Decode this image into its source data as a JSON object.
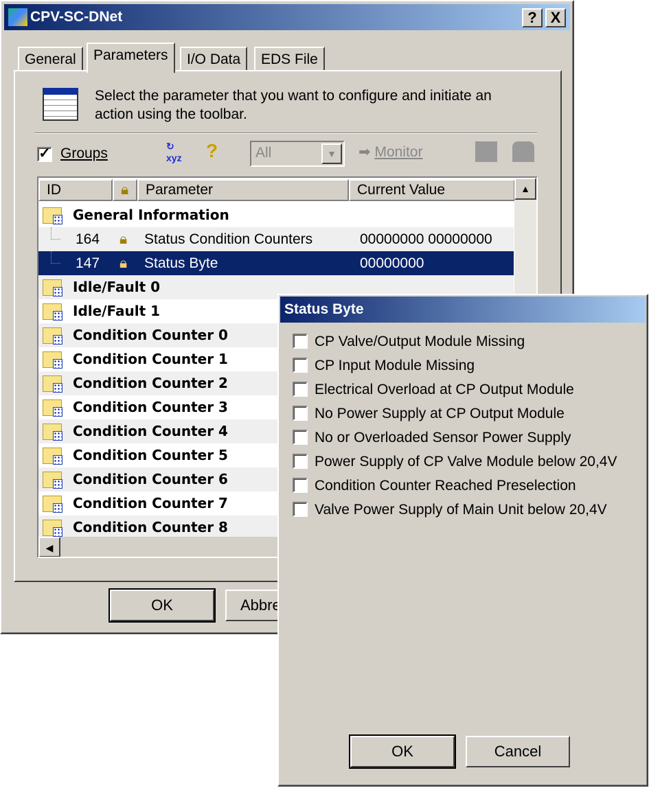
{
  "window": {
    "title": "CPV-SC-DNet",
    "help": "?",
    "close": "X"
  },
  "tabs": [
    {
      "label": "General"
    },
    {
      "label": "Parameters",
      "active": true
    },
    {
      "label": "I/O Data"
    },
    {
      "label": "EDS File"
    }
  ],
  "instruction": "Select the parameter that you want to configure and initiate an action using the toolbar.",
  "toolbar": {
    "groups_label": "Groups",
    "groups_checked": true,
    "filter_value": "All",
    "monitor_label": "Monitor"
  },
  "table": {
    "columns": [
      "ID",
      "",
      "Parameter",
      "Current Value"
    ],
    "group_general": "General Information",
    "rows": [
      {
        "id": "164",
        "parameter": "Status Condition Counters",
        "value": "00000000 00000000"
      },
      {
        "id": "147",
        "parameter": "Status Byte",
        "value": "00000000",
        "selected": true
      }
    ],
    "groups": [
      "Idle/Fault 0",
      "Idle/Fault 1",
      "Condition Counter 0",
      "Condition Counter 1",
      "Condition Counter 2",
      "Condition Counter 3",
      "Condition Counter 4",
      "Condition Counter 5",
      "Condition Counter 6",
      "Condition Counter 7",
      "Condition Counter 8"
    ]
  },
  "footer": {
    "ok": "OK",
    "abort": "Abbre"
  },
  "popup": {
    "title": "Status Byte",
    "options": [
      "CP Valve/Output Module Missing",
      "CP Input Module Missing",
      "Electrical Overload at CP Output Module",
      "No Power Supply at CP Output Module",
      "No or Overloaded Sensor Power Supply",
      "Power Supply of CP Valve Module below 20,4V",
      "Condition Counter Reached Preselection",
      "Valve Power Supply of Main Unit below 20,4V"
    ],
    "ok": "OK",
    "cancel": "Cancel"
  },
  "colors": {
    "selection": "#0a246a",
    "face": "#d4d0c8"
  }
}
